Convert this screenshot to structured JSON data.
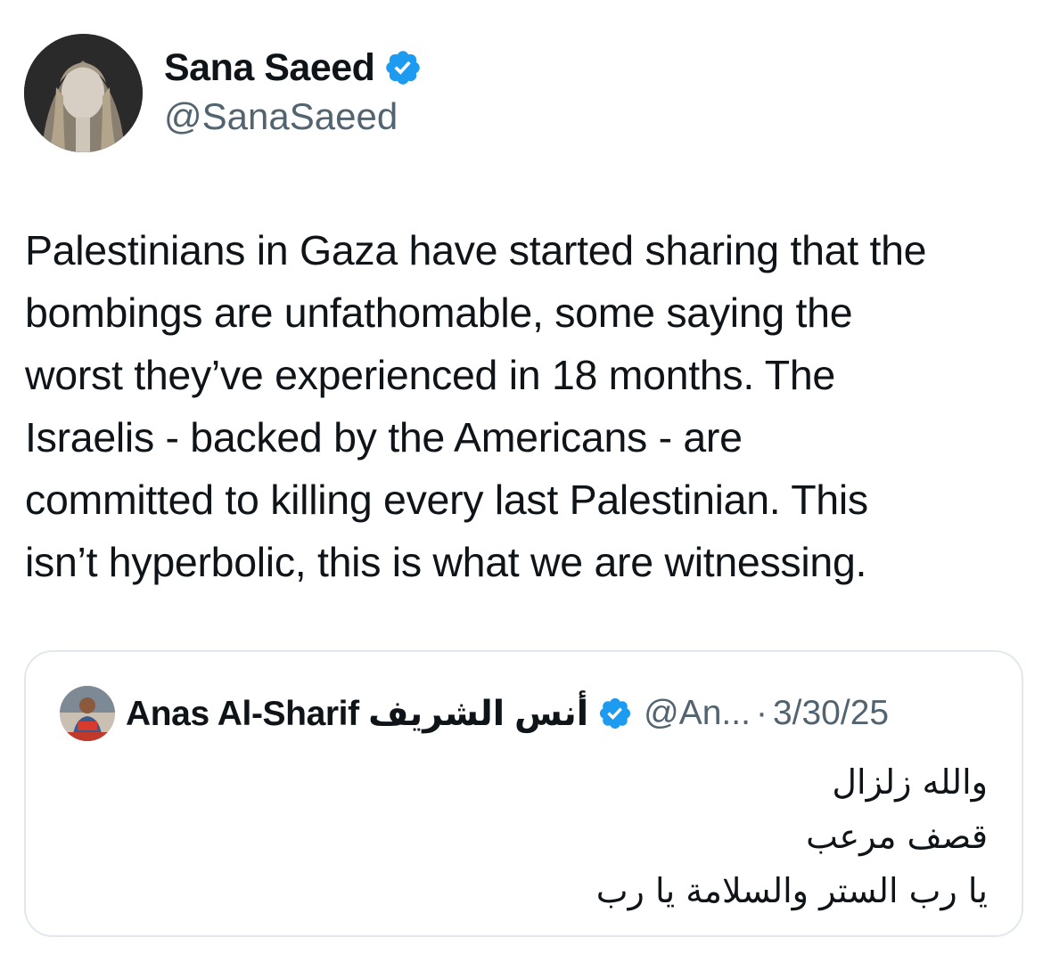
{
  "author": {
    "display_name": "Sana Saeed",
    "handle": "@SanaSaeed",
    "verified_icon": "verified-badge-icon",
    "avatar_icon": "profile-photo"
  },
  "tweet": {
    "lines": [
      "Palestinians in Gaza have started sharing that the",
      "bombings are unfathomable, some saying the",
      "worst they’ve experienced in 18 months. The",
      "Israelis - backed by the Americans - are",
      "committed to killing every last Palestinian. This",
      "isn’t hyperbolic, this is what we are witnessing."
    ]
  },
  "quoted_tweet": {
    "display_name": "Anas Al-Sharif أنس الشريف",
    "handle": "@An...",
    "separator": "·",
    "date": "3/30/25",
    "lines": [
      "والله زلزال",
      "قصف مرعب",
      "يا رب الستر والسلامة يا رب"
    ]
  },
  "colors": {
    "verified_blue": "#1d9bf0",
    "secondary_text": "#536471",
    "border": "#e1e8ed"
  }
}
